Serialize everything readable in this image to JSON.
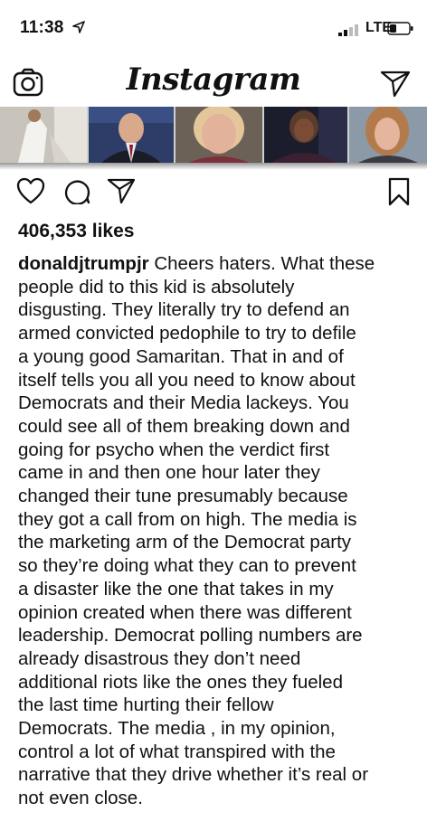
{
  "status": {
    "time": "11:38",
    "carrier": "LTE"
  },
  "app": {
    "title": "Instagram"
  },
  "post": {
    "likes": "406,353 likes",
    "username": "donaldjtrumpjr",
    "caption_lines": [
      "Cheers haters. What these",
      "people did to this kid is absolutely",
      "disgusting. They literally try to defend an",
      "armed convicted pedophile to try to defile",
      "a young good Samaritan. That in and of",
      "itself tells you all you need to know about",
      "Democrats and their Media lackeys. You",
      "could see all of them breaking down and",
      "going for psycho when the verdict first",
      "came in and then one hour later they",
      "changed their tune presumably because",
      "they got a call from on high. The media is",
      "the marketing arm of the Democrat party",
      "so they’re doing what they can to prevent",
      "a disaster like the one that takes in my",
      "opinion created when there was different",
      "leadership. Democrat polling numbers are",
      "already disastrous they don’t need",
      "additional riots like the ones they fueled",
      "the last time hurting their fellow",
      "Democrats. The media , in my opinion,",
      "control a lot of what transpired with the",
      "narrative that they drive whether it’s real or",
      "not even close."
    ]
  },
  "icons": {
    "location": "location-arrow-icon",
    "signal": "signal-bars-icon",
    "battery": "battery-icon",
    "camera": "camera-icon",
    "send": "direct-message-icon",
    "like": "heart-icon",
    "comment": "comment-icon",
    "share": "share-icon",
    "save": "bookmark-icon"
  }
}
